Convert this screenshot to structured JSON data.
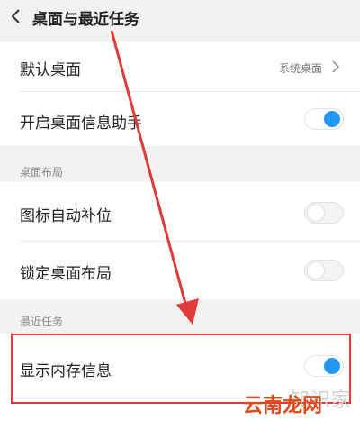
{
  "header": {
    "title": "桌面与最近任务"
  },
  "rows": {
    "default_desktop": {
      "label": "默认桌面",
      "value": "系统桌面"
    },
    "desktop_info_assistant": {
      "label": "开启桌面信息助手",
      "state": "on"
    },
    "auto_fill_icons": {
      "label": "图标自动补位",
      "state": "off"
    },
    "lock_desktop_layout": {
      "label": "锁定桌面布局",
      "state": "off"
    },
    "show_memory_info": {
      "label": "显示内存信息",
      "state": "on"
    }
  },
  "sections": {
    "desktop_layout": "桌面布局",
    "recent_tasks": "最近任务"
  },
  "watermark": {
    "faded": "知识家",
    "brand": "云南龙网"
  },
  "colors": {
    "accent": "#2196f3",
    "annotation": "#e03a3a"
  }
}
